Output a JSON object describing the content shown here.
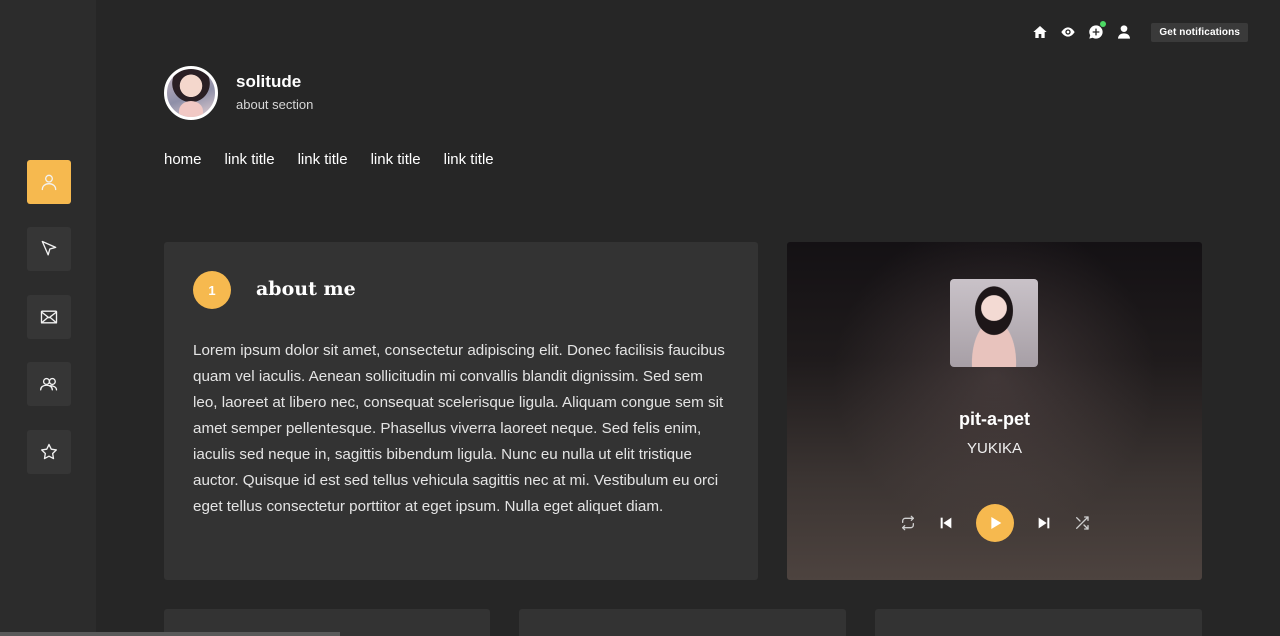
{
  "topbar": {
    "icons": [
      "home-icon",
      "eye-icon",
      "add-chat-icon",
      "user-icon"
    ],
    "notifications_label": "Get notifications"
  },
  "sidebar": {
    "items": [
      {
        "icon": "user-icon",
        "active": true
      },
      {
        "icon": "send-icon",
        "active": false
      },
      {
        "icon": "mail-icon",
        "active": false
      },
      {
        "icon": "users-icon",
        "active": false
      },
      {
        "icon": "star-icon",
        "active": false
      }
    ]
  },
  "profile": {
    "name": "solitude",
    "subtitle": "about section"
  },
  "nav": {
    "links": [
      "home",
      "link title",
      "link title",
      "link title",
      "link title"
    ]
  },
  "about": {
    "badge": "1",
    "title": "about me",
    "body": "Lorem ipsum dolor sit amet, consectetur adipiscing elit. Donec facilisis faucibus quam vel iaculis. Aenean sollicitudin mi convallis blandit dignissim. Sed sem leo, laoreet at libero nec, consequat scelerisque ligula. Aliquam congue sem sit amet semper pellentesque. Phasellus viverra laoreet neque. Sed felis enim, iaculis sed neque in, sagittis bibendum ligula. Nunc eu nulla ut elit tristique auctor. Quisque id est sed tellus vehicula sagittis nec at mi. Vestibulum eu orci eget tellus consectetur porttitor at eget ipsum. Nulla eget aliquet diam."
  },
  "player": {
    "title": "pit-a-pet",
    "artist": "YUKIKA",
    "controls": [
      "repeat-icon",
      "previous-icon",
      "play-icon",
      "next-icon",
      "shuffle-icon"
    ]
  },
  "colors": {
    "accent": "#f6b94f",
    "background": "#262626",
    "sidebar": "#2c2c2c",
    "card": "#333333",
    "status_dot": "#4cd964"
  }
}
